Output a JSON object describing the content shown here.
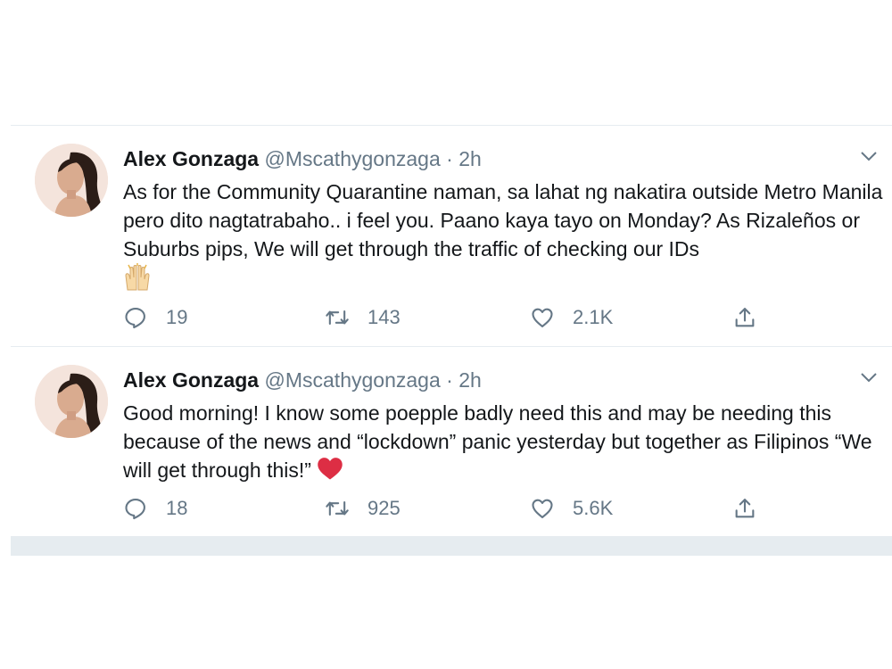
{
  "tweets": [
    {
      "author_name": "Alex Gonzaga",
      "handle": "@Mscathygonzaga",
      "separator": "·",
      "time": "2h",
      "text": "As for the Community Quarantine naman, sa lahat ng nakatira outside Metro Manila pero dito nagtatrabaho.. i feel you. Paano kaya tayo on Monday? As Rizaleños or Suburbs pips, We will get through the traffic of checking our IDs",
      "trailing_emoji": "raising-hands-emoji",
      "replies": "19",
      "retweets": "143",
      "likes": "2.1K"
    },
    {
      "author_name": "Alex Gonzaga",
      "handle": "@Mscathygonzaga",
      "separator": "·",
      "time": "2h",
      "text": "Good morning! I know some poepple badly need this and may be needing this because of the news and “lockdown” panic yesterday but together as Filipinos “We will get through this!”",
      "trailing_emoji": "red-heart-emoji",
      "replies": "18",
      "retweets": "925",
      "likes": "5.6K"
    }
  ],
  "colors": {
    "text_primary": "#14171a",
    "text_secondary": "#657786",
    "divider": "#e6ecf0",
    "heart": "#e0245e"
  }
}
